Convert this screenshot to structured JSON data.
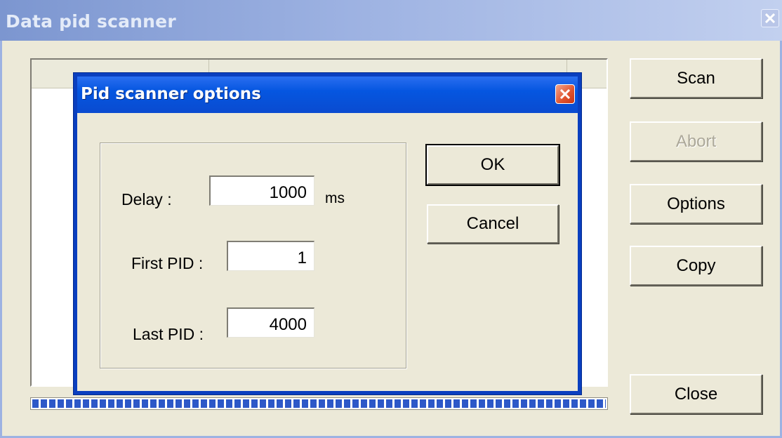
{
  "main_window": {
    "title": "Data pid scanner",
    "buttons": {
      "scan": "Scan",
      "abort": "Abort",
      "options": "Options",
      "copy": "Copy",
      "close": "Close"
    },
    "progress_percent": 100
  },
  "dialog": {
    "title": "Pid scanner options",
    "fields": {
      "delay_label": "Delay :",
      "delay_value": "1000",
      "delay_unit": "ms",
      "first_pid_label": "First PID :",
      "first_pid_value": "1",
      "last_pid_label": "Last PID :",
      "last_pid_value": "4000"
    },
    "buttons": {
      "ok": "OK",
      "cancel": "Cancel"
    }
  },
  "colors": {
    "active_title": "#0a4bd0",
    "inactive_title": "#9db2e2",
    "face": "#ece9d8",
    "progress": "#2d58c8"
  }
}
